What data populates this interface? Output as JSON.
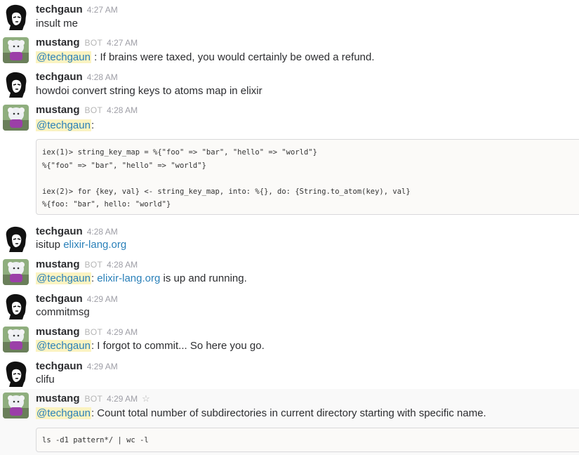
{
  "messages": [
    {
      "user": "techgaun",
      "time": "4:27 AM",
      "text": "insult me"
    },
    {
      "user": "mustang",
      "bot": "BOT",
      "time": "4:27 AM",
      "mention": "@techgaun",
      "text": " : If brains were taxed, you would certainly be owed a refund."
    },
    {
      "user": "techgaun",
      "time": "4:28 AM",
      "text": "howdoi convert string keys to atoms map in elixir"
    },
    {
      "user": "mustang",
      "bot": "BOT",
      "time": "4:28 AM",
      "mention": "@techgaun",
      "text": ":",
      "code": [
        "iex(1)> string_key_map = %{\"foo\" => \"bar\", \"hello\" => \"world\"}",
        "%{\"foo\" => \"bar\", \"hello\" => \"world\"}",
        "",
        "iex(2)> for {key, val} <- string_key_map, into: %{}, do: {String.to_atom(key), val}",
        "%{foo: \"bar\", hello: \"world\"}"
      ]
    },
    {
      "user": "techgaun",
      "time": "4:28 AM",
      "text": "isitup ",
      "link": "elixir-lang.org"
    },
    {
      "user": "mustang",
      "bot": "BOT",
      "time": "4:28 AM",
      "mention": "@techgaun",
      "text": ": ",
      "link": "elixir-lang.org",
      "text_after": " is up and running."
    },
    {
      "user": "techgaun",
      "time": "4:29 AM",
      "text": "commitmsg"
    },
    {
      "user": "mustang",
      "bot": "BOT",
      "time": "4:29 AM",
      "mention": "@techgaun",
      "text": ": I forgot to commit... So here you go."
    },
    {
      "user": "techgaun",
      "time": "4:29 AM",
      "text": "clifu"
    },
    {
      "user": "mustang",
      "bot": "BOT",
      "time": "4:29 AM",
      "mention": "@techgaun",
      "text": ": Count total number of subdirectories in current directory starting with specific name.",
      "code": [
        "ls -d1 pattern*/ | wc -l"
      ]
    }
  ],
  "icons": {
    "star": "star-icon"
  }
}
